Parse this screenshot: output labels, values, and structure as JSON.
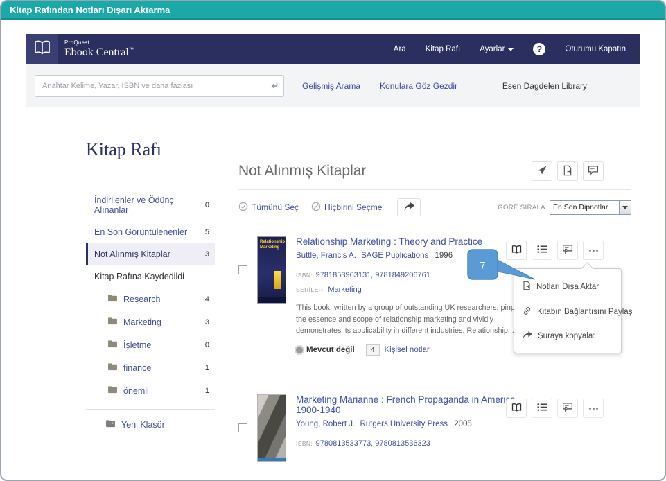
{
  "title_bar": {
    "text": "Kitap Rafından Notları Dışarı Aktarma"
  },
  "navbar": {
    "brand_top": "ProQuest",
    "brand_name": "Ebook Central",
    "brand_tm": "™",
    "items": {
      "search": "Ara",
      "bookshelf": "Kitap Rafı",
      "settings": "Ayarlar",
      "help": "?",
      "signout": "Oturumu Kapatın"
    }
  },
  "search": {
    "placeholder": "Anahtar Kelime, Yazar, ISBN ve daha fazlası",
    "advanced": "Gelişmiş Arama",
    "browse": "Konulara Göz Gezdir",
    "library": "Esen Dagdelen Library"
  },
  "sidebar": {
    "heading": "Kitap Rafı",
    "items": [
      {
        "label": "İndirilenler ve Ödünç Alınanlar",
        "count": "0"
      },
      {
        "label": "En Son Görüntülenenler",
        "count": "5"
      },
      {
        "label": "Not Alınmış Kitaplar",
        "count": "3"
      },
      {
        "label": "Kitap Rafına Kaydedildi",
        "count": ""
      }
    ],
    "folders": [
      {
        "label": "Research",
        "count": "4"
      },
      {
        "label": "Marketing",
        "count": "3"
      },
      {
        "label": "İşletme",
        "count": "0"
      },
      {
        "label": "finance",
        "count": "1"
      },
      {
        "label": "önemli",
        "count": "1"
      }
    ],
    "new_folder": "Yeni Klasör"
  },
  "main": {
    "heading": "Not Alınmış Kitaplar",
    "select_all": "Tümünü Seç",
    "select_none": "Hiçbirini Seçme",
    "sort_label": "GÖRE SIRALA",
    "sort_value": "En Son Dipnotlar",
    "books": [
      {
        "title": "Relationship Marketing : Theory and Practice",
        "author": "Buttle, Francis A.",
        "publisher": "SAGE Publications",
        "year": "1996",
        "isbn_label": "ISBN:",
        "isbn": "9781853963131, 9781849206761",
        "series_label": "SERİLER:",
        "series": "Marketing",
        "description": "'This book, written by a group of outstanding UK researchers, pinpoints the essence and scope of relationship marketing and vividly demonstrates its applicability in different industries. Relationship...",
        "availability": "Mevcut değil",
        "notes_count": "4",
        "notes_label": "Kişisel notlar",
        "cover_text": "Relationship Marketing"
      },
      {
        "title": "Marketing Marianne : French Propaganda in America, 1900-1940",
        "author": "Young, Robert J.",
        "publisher": "Rutgers University Press",
        "year": "2005",
        "isbn_label": "ISBN:",
        "isbn": "9780813533773, 9780813536323"
      }
    ],
    "context_menu": {
      "export": "Notları Dışa Aktar",
      "share_link": "Kitabın Bağlantısını Paylaş",
      "copy_to": "Şuraya kopyala:"
    },
    "callout_number": "7"
  },
  "icons": {
    "logo": "open-book",
    "help": "question-circle",
    "settings_caret": "caret-down",
    "search_submit": "return-arrow",
    "toolbar": [
      "send-paper-plane",
      "export-document",
      "annotations-bubble"
    ],
    "select_all": "circle-check",
    "select_none": "circle-slash",
    "share_button": "curved-arrow",
    "book_actions": [
      "read-open-book",
      "toc-bullet-list",
      "annotations-bubble",
      "more-ellipsis"
    ],
    "menu": [
      "export-document",
      "link-chain",
      "curved-arrow"
    ],
    "availability": "gray-dot",
    "folder": "folder",
    "new_folder": "folder-plus"
  },
  "colors": {
    "teal_accent": "#1aa9a7",
    "navbar_navy": "#2b2f60",
    "link_navy": "#4150a0",
    "callout_blue": "#5b9bd5"
  }
}
